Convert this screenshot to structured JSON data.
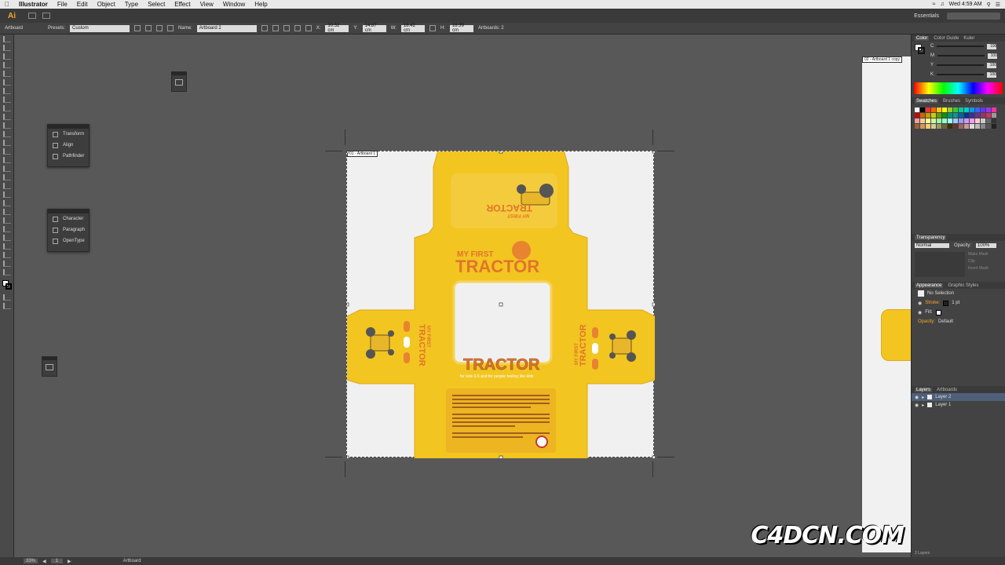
{
  "menubar": {
    "app": "Illustrator",
    "items": [
      "File",
      "Edit",
      "Object",
      "Type",
      "Select",
      "Effect",
      "View",
      "Window",
      "Help"
    ],
    "clock": "Wed 4:59 AM"
  },
  "appbar": {
    "logo": "Ai",
    "workspace": "Essentials"
  },
  "controlbar": {
    "mode": "Artboard",
    "presets_label": "Presets:",
    "presets_value": "Custom",
    "name_label": "Name:",
    "name_value": "Artboard 2",
    "x_label": "X:",
    "x_value": "10.52 cm",
    "y_label": "Y:",
    "y_value": "14.87 cm",
    "w_label": "W:",
    "w_value": "18.42 cm",
    "h_label": "H:",
    "h_value": "18.39 cm",
    "artboards": "Artboards: 2"
  },
  "float_panel_1": [
    "Transform",
    "Align",
    "Pathfinder"
  ],
  "float_panel_2": [
    "Character",
    "Paragraph",
    "OpenType"
  ],
  "artboard_label": "01 - Artboard 1",
  "artboard2_label": "02 - Artboard 1 copy",
  "package": {
    "brand_top": "MY FIRST",
    "brand_main": "TRACTOR",
    "tagline": "for kids 3-5 and for people feeling like kids"
  },
  "color_panel": {
    "tabs": [
      "Color",
      "Color Guide",
      "Kuler"
    ],
    "channels": [
      {
        "k": "C",
        "v": "100"
      },
      {
        "k": "M",
        "v": "100"
      },
      {
        "k": "Y",
        "v": "100"
      },
      {
        "k": "K",
        "v": "100"
      }
    ]
  },
  "swatches_panel": {
    "tabs": [
      "Swatches",
      "Brushes",
      "Symbols"
    ]
  },
  "transparency_panel": {
    "title": "Transparency",
    "blend": "Normal",
    "opacity_label": "Opacity:",
    "opacity_value": "100%",
    "opts": [
      "Make Mask",
      "Clip",
      "Invert Mask"
    ]
  },
  "appearance_panel": {
    "tabs": [
      "Appearance",
      "Graphic Styles"
    ],
    "selection": "No Selection",
    "stroke_label": "Stroke:",
    "stroke_value": "1 pt",
    "fill_label": "Fill:",
    "opacity_label": "Opacity:",
    "opacity_value": "Default"
  },
  "layers_panel": {
    "tabs": [
      "Layers",
      "Artboards"
    ],
    "layers": [
      "Layer 2",
      "Layer 1"
    ],
    "footer": "2 Layers"
  },
  "status": {
    "zoom": "33%",
    "page": "1",
    "mode": "Artboard"
  },
  "watermark": "C4DCN.COM",
  "colors": {
    "accent": "#f7a824",
    "box_yellow": "#f2c521",
    "brand_orange": "#e2742b"
  }
}
